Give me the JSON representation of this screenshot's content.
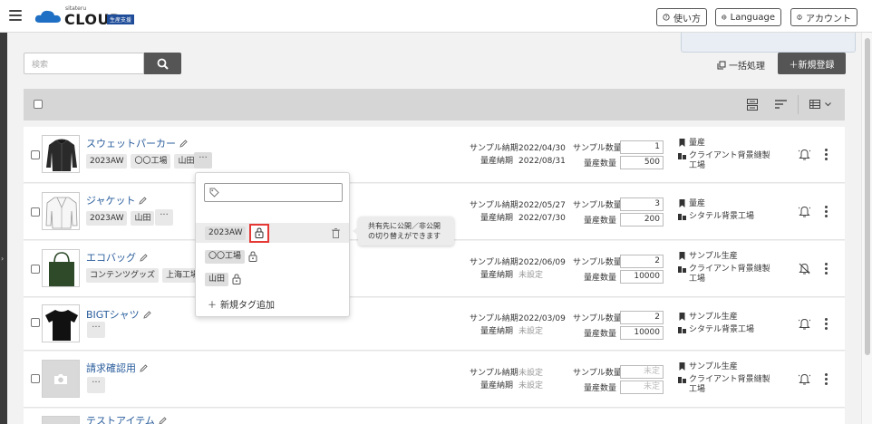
{
  "header": {
    "logo_small": "sitateru",
    "logo_main": "CLOUD",
    "logo_badge": "生産支援",
    "help_label": "使い方",
    "language_label": "Language",
    "account_label": "アカウント"
  },
  "toolbar": {
    "search_placeholder": "検索",
    "bulk_label": "一括処理",
    "new_label": "＋新規登録"
  },
  "labels": {
    "sample_delivery": "サンプル納期",
    "mass_delivery": "量産納期",
    "sample_qty": "サンプル数量",
    "mass_qty": "量産数量",
    "more": "···"
  },
  "products": [
    {
      "name": "スウェットパーカー",
      "tags": [
        "2023AW",
        "〇〇工場",
        "山田"
      ],
      "sample_date": "2022/04/30",
      "mass_date": "2022/08/31",
      "sample_qty": "1",
      "mass_qty": "500",
      "phase": "量産",
      "factory": "クライアント背景縫製工場",
      "bell": "on"
    },
    {
      "name": "ジャケット",
      "tags": [
        "2023AW",
        "山田"
      ],
      "sample_date": "2022/05/27",
      "mass_date": "2022/07/30",
      "sample_qty": "3",
      "mass_qty": "200",
      "phase": "量産",
      "factory": "シタテル背景工場",
      "bell": "on"
    },
    {
      "name": "エコバッグ",
      "tags": [
        "コンテンツグッズ",
        "上海工場"
      ],
      "sample_date": "2022/06/09",
      "mass_date": "未設定",
      "sample_qty": "2",
      "mass_qty": "10000",
      "phase": "サンプル生産",
      "factory": "クライアント背景縫製工場",
      "bell": "off"
    },
    {
      "name": "BIGTシャツ",
      "tags": [],
      "sample_date": "2022/03/09",
      "mass_date": "未設定",
      "sample_qty": "2",
      "mass_qty": "10000",
      "phase": "サンプル生産",
      "factory": "シタテル背景工場",
      "bell": "on"
    },
    {
      "name": "請求確認用",
      "tags": [],
      "sample_date": "未設定",
      "mass_date": "未設定",
      "sample_qty": "未定",
      "mass_qty": "未定",
      "phase": "サンプル生産",
      "factory": "クライアント背景縫製工場",
      "bell": "on"
    },
    {
      "name": "テストアイテム",
      "tags": []
    }
  ],
  "tag_popup": {
    "tags": [
      "2023AW",
      "〇〇工場",
      "山田"
    ],
    "add_label": "新規タグ追加"
  },
  "tooltip": {
    "line1": "共有先に公開／非公開",
    "line2": "の切り替えができます"
  },
  "colors": {
    "link": "#2a5d9c",
    "highlight_border": "#e53935",
    "dark_button": "#555555",
    "badge": "#1f4d99"
  }
}
